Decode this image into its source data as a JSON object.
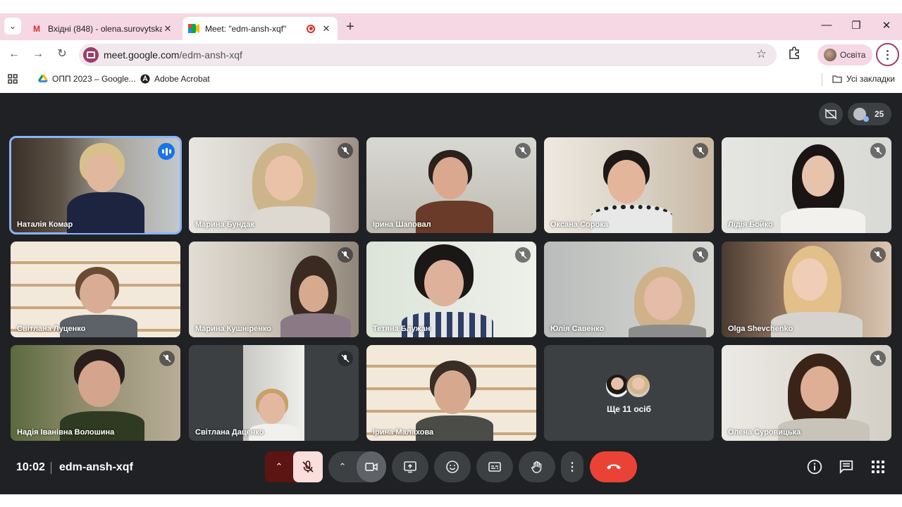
{
  "browser": {
    "tabs": [
      {
        "title": "Вхідні (848) - olena.surovytska@",
        "favicon": "gmail-icon",
        "active": false
      },
      {
        "title": "Meet: \"edm-ansh-xqf\"",
        "favicon": "meet-icon",
        "active": true,
        "recording": true
      }
    ],
    "url_domain": "meet.google.com",
    "url_path": "/edm-ansh-xqf",
    "profile_label": "Освіта",
    "bookmarks": [
      {
        "label": "ОПП 2023 – Google...",
        "icon": "google-drive-icon"
      },
      {
        "label": "Adobe Acrobat",
        "icon": "acrobat-icon"
      }
    ],
    "all_bookmarks_label": "Усі закладки"
  },
  "meeting": {
    "participant_count": "25",
    "time": "10:02",
    "code": "edm-ansh-xqf",
    "tiles": [
      {
        "name": "Наталія Комар",
        "speaking": true
      },
      {
        "name": "Марина Бундак"
      },
      {
        "name": "Ірина Шаповал"
      },
      {
        "name": "Оксана Сорока"
      },
      {
        "name": "Лідія Бойко"
      },
      {
        "name": "Світлана Луценко"
      },
      {
        "name": "Марина Кушніренко"
      },
      {
        "name": "Тетяна Блужан"
      },
      {
        "name": "Юлія Савенко"
      },
      {
        "name": "Olga Shevchenko"
      },
      {
        "name": "Надія Іванівна Волошина"
      },
      {
        "name": "Світлана Даценко"
      },
      {
        "name": "Ірина Малахова"
      },
      {
        "name": "Олена Суровицька"
      }
    ],
    "more_label": "Ще 11 осіб"
  },
  "colors": {
    "meet_bg": "#202124",
    "leave_red": "#ea4335",
    "speaking_blue": "#8ab4f8",
    "tab_bar_pink": "#f6d7e4"
  }
}
